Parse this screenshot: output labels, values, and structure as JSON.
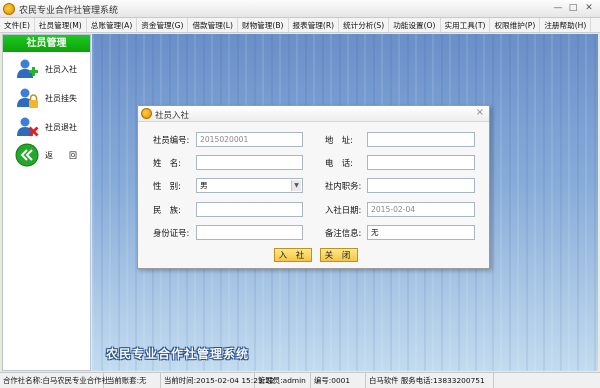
{
  "window": {
    "title": "农民专业合作社管理系统",
    "controls": [
      "—",
      "□",
      "✕"
    ]
  },
  "menu": [
    "文件(E)",
    "社员管理(M)",
    "总账管理(A)",
    "资金管理(G)",
    "借款管理(L)",
    "财物管理(B)",
    "报表管理(R)",
    "统计分析(S)",
    "功能设置(O)",
    "实用工具(T)",
    "权限维护(P)",
    "注册帮助(H)"
  ],
  "sidebar": {
    "title": "社员管理",
    "items": [
      {
        "label": "社员入社",
        "icon": "user-add-icon"
      },
      {
        "label": "社员挂失",
        "icon": "user-lock-icon"
      },
      {
        "label": "社员退社",
        "icon": "user-remove-icon"
      },
      {
        "label": "返　　回",
        "icon": "back-icon"
      }
    ]
  },
  "workspace": {
    "watermark": "农民专业合作社管理系统"
  },
  "dialog": {
    "title": "社员入社",
    "close": "×",
    "fields": {
      "member_no": {
        "label": "社员编号:",
        "value": "2015020001"
      },
      "address": {
        "label": "地　址:",
        "value": ""
      },
      "name": {
        "label": "姓　名:",
        "value": ""
      },
      "phone": {
        "label": "电　话:",
        "value": ""
      },
      "gender": {
        "label": "性　别:",
        "value": "男"
      },
      "position": {
        "label": "社内职务:",
        "value": ""
      },
      "ethnicity": {
        "label": "民　族:",
        "value": ""
      },
      "join_date": {
        "label": "入社日期:",
        "value": "2015-02-04"
      },
      "id_no": {
        "label": "身份证号:",
        "value": ""
      },
      "remark": {
        "label": "备注信息:",
        "value": "无"
      }
    },
    "buttons": {
      "join": "入 社",
      "close": "关 闭"
    }
  },
  "statusbar": {
    "org": "合作社名称:白马农民专业合作社",
    "account": "当前账套:无",
    "time": "当前时间:2015-02-04 15:23:22",
    "admin": "管理员:admin",
    "code": "编号:0001",
    "company": "白马软件 服务电话:13833200751"
  },
  "colors": {
    "sidebar_header": "#0aa30a",
    "button": "#f5c443",
    "workspace": "#88acd9"
  }
}
